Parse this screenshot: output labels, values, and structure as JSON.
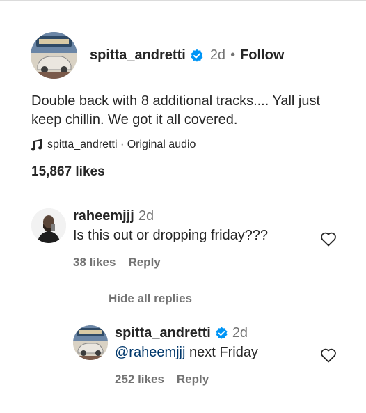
{
  "post": {
    "username": "spitta_andretti",
    "time": "2d",
    "separator": "•",
    "follow_label": "Follow",
    "caption": "Double back with 8 additional tracks.... Yall just keep chillin. We got it all covered.",
    "audio": "spitta_andretti · Original audio",
    "likes": "15,867 likes"
  },
  "comments": [
    {
      "username": "raheemjjj",
      "time": "2d",
      "text": "Is this out or dropping friday???",
      "likes": "38 likes",
      "reply_label": "Reply"
    }
  ],
  "hide_replies_label": "Hide all replies",
  "replies": [
    {
      "username": "spitta_andretti",
      "time": "2d",
      "mention": "@raheemjjj",
      "text": " next Friday",
      "likes": "252 likes",
      "reply_label": "Reply"
    }
  ],
  "colors": {
    "verified": "#0095f6",
    "muted": "#737373",
    "mention": "#00376b"
  },
  "icons": [
    "verified-badge-icon",
    "music-note-icon",
    "heart-icon"
  ]
}
